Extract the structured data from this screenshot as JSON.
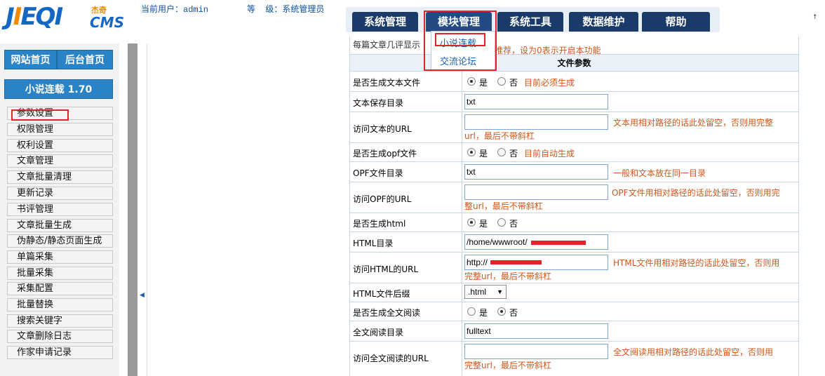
{
  "header": {
    "logo": {
      "mark_pre": "J",
      "mark_q": "I",
      "mark_post": "EQI",
      "cn": "杰奇",
      "cms": "CMS"
    },
    "current_user": "当前用户：admin",
    "level": "等  级：系统管理员"
  },
  "nav": {
    "tabs": [
      "系统管理",
      "模块管理",
      "系统工具",
      "数据维护",
      "帮助"
    ],
    "dropdown": [
      "小说连载",
      "交流论坛"
    ]
  },
  "sidebar": {
    "site_home": "网站首页",
    "admin_home": "后台首页",
    "version": "小说连载 1.70",
    "menu": [
      "参数设置",
      "权限管理",
      "权利设置",
      "文章管理",
      "文章批量清理",
      "更新记录",
      "书评管理",
      "文章批量生成",
      "伪静态/静态页面生成",
      "单篇采集",
      "批量采集",
      "采集配置",
      "批量替换",
      "搜索关键字",
      "文章删除日志",
      "作家申请记录"
    ]
  },
  "form": {
    "top_partial_label": "每篇文章几评显示",
    "top_partial_hint": "推荐，设为0表示开启本功能",
    "section_title": "文件参数",
    "yes": "是",
    "no": "否",
    "rows": {
      "gen_text": {
        "label": "是否生成文本文件",
        "hint": "目前必须生成"
      },
      "text_dir": {
        "label": "文本保存目录",
        "value": "txt"
      },
      "text_url": {
        "label": "访问文本的URL",
        "value": "",
        "hint1": "文本用相对路径的话此处留空，否则用完整",
        "hint2": "url，最后不带斜杠"
      },
      "gen_opf": {
        "label": "是否生成opf文件",
        "hint": "目前自动生成"
      },
      "opf_dir": {
        "label": "OPF文件目录",
        "value": "txt",
        "hint": "一般和文本放在同一目录"
      },
      "opf_url": {
        "label": "访问OPF的URL",
        "value": "",
        "hint1": "OPF文件用相对路径的话此处留空，否则用完",
        "hint2": "整url，最后不带斜杠"
      },
      "gen_html": {
        "label": "是否生成html"
      },
      "html_dir": {
        "label": "HTML目录",
        "value": "/home/wwwroot/"
      },
      "html_url": {
        "label": "访问HTML的URL",
        "value": "http://",
        "hint1": "HTML文件用相对路径的话此处留空，否则用",
        "hint2": "完整url，最后不带斜杠"
      },
      "html_ext": {
        "label": "HTML文件后缀",
        "value": ".html"
      },
      "gen_full": {
        "label": "是否生成全文阅读"
      },
      "full_dir": {
        "label": "全文阅读目录",
        "value": "fulltext"
      },
      "full_url": {
        "label": "访问全文阅读的URL",
        "value": "",
        "hint1": "全文阅读用相对路径的话此处留空，否则用",
        "hint2": "完整url，最后不带斜杠"
      }
    }
  },
  "icons": {
    "collapse": "chevron-left-icon",
    "scroll_up": "scroll-up-arrow-icon"
  },
  "colors": {
    "accent": "#2a82c7",
    "nav": "#1a3a6a",
    "hint": "#d2561a",
    "highlight": "#e0242a"
  }
}
